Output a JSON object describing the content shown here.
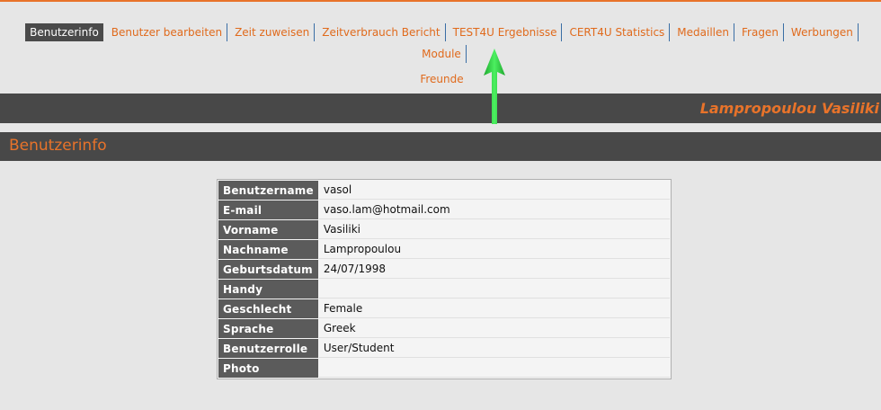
{
  "nav": {
    "items": [
      {
        "label": "Benutzerinfo",
        "active": true
      },
      {
        "label": "Benutzer bearbeiten"
      },
      {
        "label": "Zeit zuweisen"
      },
      {
        "label": "Zeitverbrauch Bericht"
      },
      {
        "label": "TEST4U Ergebnisse"
      },
      {
        "label": "CERT4U Statistics"
      },
      {
        "label": "Medaillen"
      },
      {
        "label": "Fragen"
      },
      {
        "label": "Werbungen"
      },
      {
        "label": "Module"
      },
      {
        "label": "Freunde"
      }
    ]
  },
  "header": {
    "user_name": "Lampropoulou Vasiliki"
  },
  "section": {
    "title": "Benutzerinfo"
  },
  "user_info": {
    "rows": [
      {
        "label": "Benutzername",
        "value": "vasol"
      },
      {
        "label": "E-mail",
        "value": "vaso.lam@hotmail.com"
      },
      {
        "label": "Vorname",
        "value": "Vasiliki"
      },
      {
        "label": "Nachname",
        "value": "Lampropoulou"
      },
      {
        "label": "Geburtsdatum",
        "value": "24/07/1998"
      },
      {
        "label": "Handy",
        "value": ""
      },
      {
        "label": "Geschlecht",
        "value": "Female"
      },
      {
        "label": "Sprache",
        "value": "Greek"
      },
      {
        "label": "Benutzerrolle",
        "value": "User/Student"
      },
      {
        "label": "Photo",
        "value": ""
      }
    ]
  },
  "colors": {
    "accent": "#e8732a",
    "bar": "#484848",
    "arrow": "#2ecc40"
  }
}
